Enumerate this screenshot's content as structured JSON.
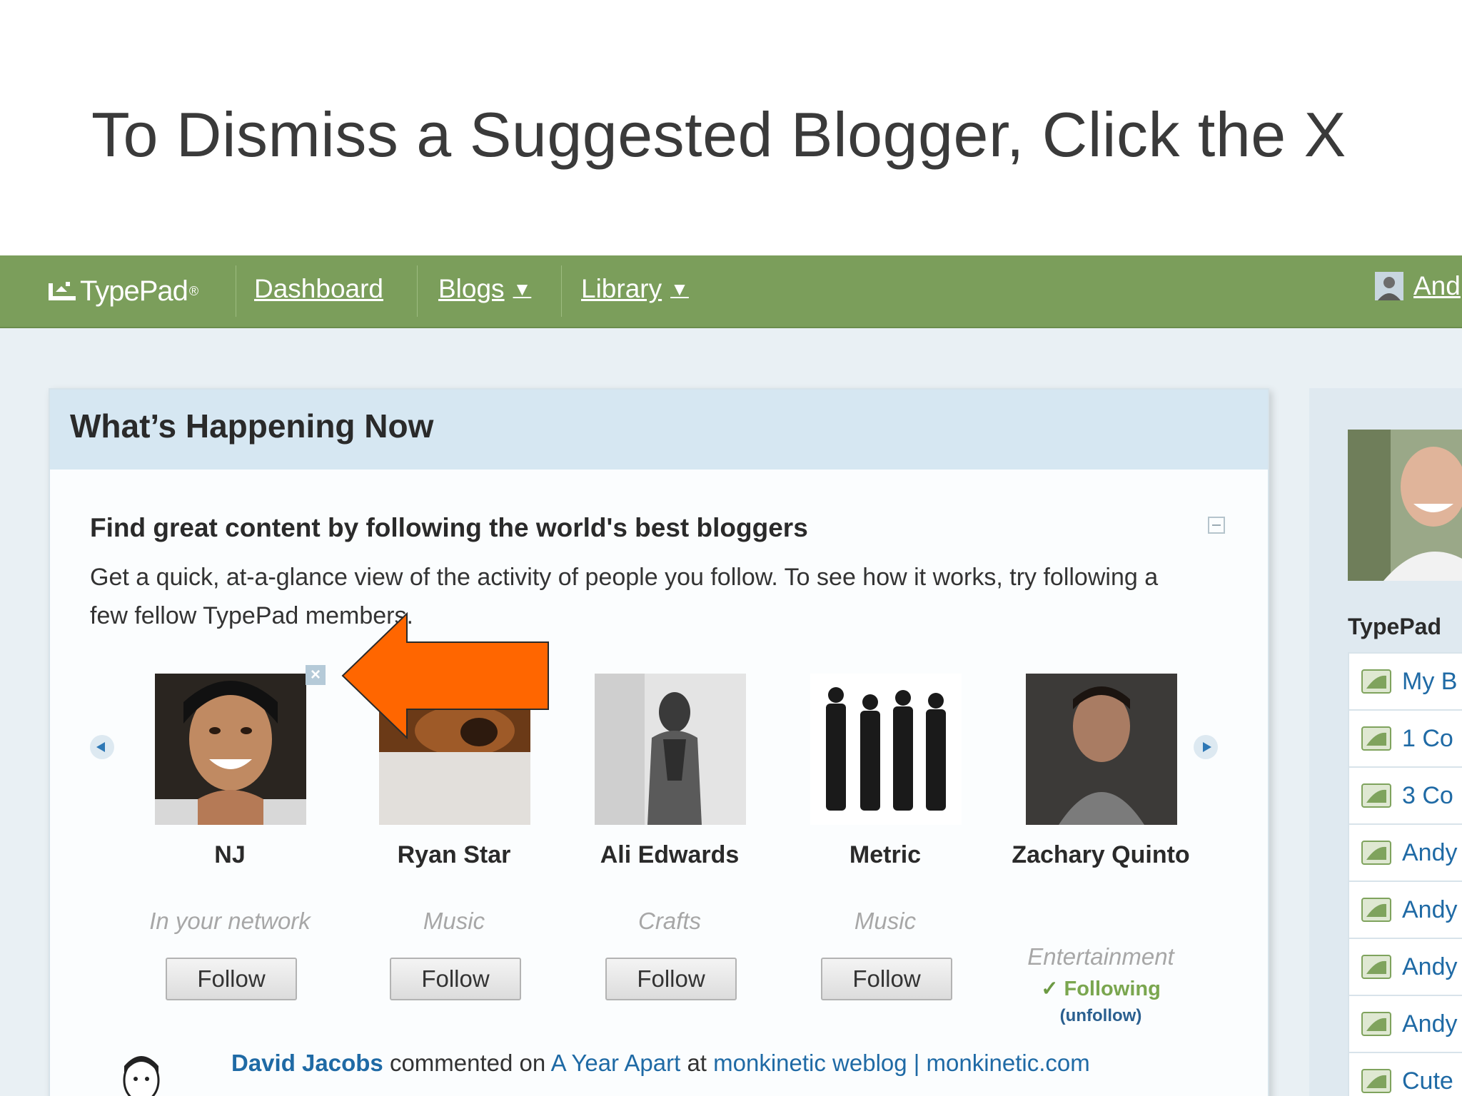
{
  "slide": {
    "title": "To Dismiss a Suggested Blogger, Click the X"
  },
  "nav": {
    "logo": "TypePad",
    "logo_mark": "®",
    "items": [
      {
        "label": "Dashboard"
      },
      {
        "label": "Blogs",
        "caret": "▼"
      },
      {
        "label": "Library",
        "caret": "▼"
      }
    ],
    "user_label": "And"
  },
  "panel": {
    "title": "What’s Happening Now",
    "find_title": "Find great content by following the world's best bloggers",
    "description": "Get a quick, at-a-glance view of the activity of people you follow. To see how it works, try following a few fellow TypePad members.",
    "dismiss_symbol": "×",
    "bloggers": [
      {
        "name": "NJ",
        "category": "In your network",
        "action": "Follow"
      },
      {
        "name": "Ryan Star",
        "category": "Music",
        "action": "Follow"
      },
      {
        "name": "Ali Edwards",
        "category": "Crafts",
        "action": "Follow"
      },
      {
        "name": "Metric",
        "category": "Music",
        "action": "Follow"
      },
      {
        "name": "Zachary Quinto",
        "category": "Entertainment",
        "status": "Following",
        "status_mark": "✓",
        "unfollow_label": "unfollow",
        "unfollow_open": "(",
        "unfollow_close": ")"
      }
    ],
    "activity": {
      "user": "David Jacobs",
      "verb": "commented on",
      "post": "A Year Apart",
      "at": "at",
      "blog": "monkinetic weblog | monkinetic.com"
    }
  },
  "sidebar": {
    "heading": "TypePad",
    "items": [
      {
        "label": "My B"
      },
      {
        "label": "1 Co"
      },
      {
        "label": "3 Co"
      },
      {
        "label": "Andy"
      },
      {
        "label": "Andy"
      },
      {
        "label": "Andy"
      },
      {
        "label": "Andy"
      },
      {
        "label": "Cute"
      }
    ]
  },
  "colors": {
    "nav_bg": "#7b9e5b",
    "panel_head_bg": "#d6e7f2",
    "link": "#1f6aa5",
    "following_green": "#7aa64f",
    "callout_arrow": "#ff6600"
  },
  "icons": [
    "typepad-logo-icon",
    "user-avatar-icon",
    "carousel-prev-icon",
    "carousel-next-icon",
    "collapse-icon",
    "close-icon",
    "check-icon",
    "blog-icon"
  ]
}
